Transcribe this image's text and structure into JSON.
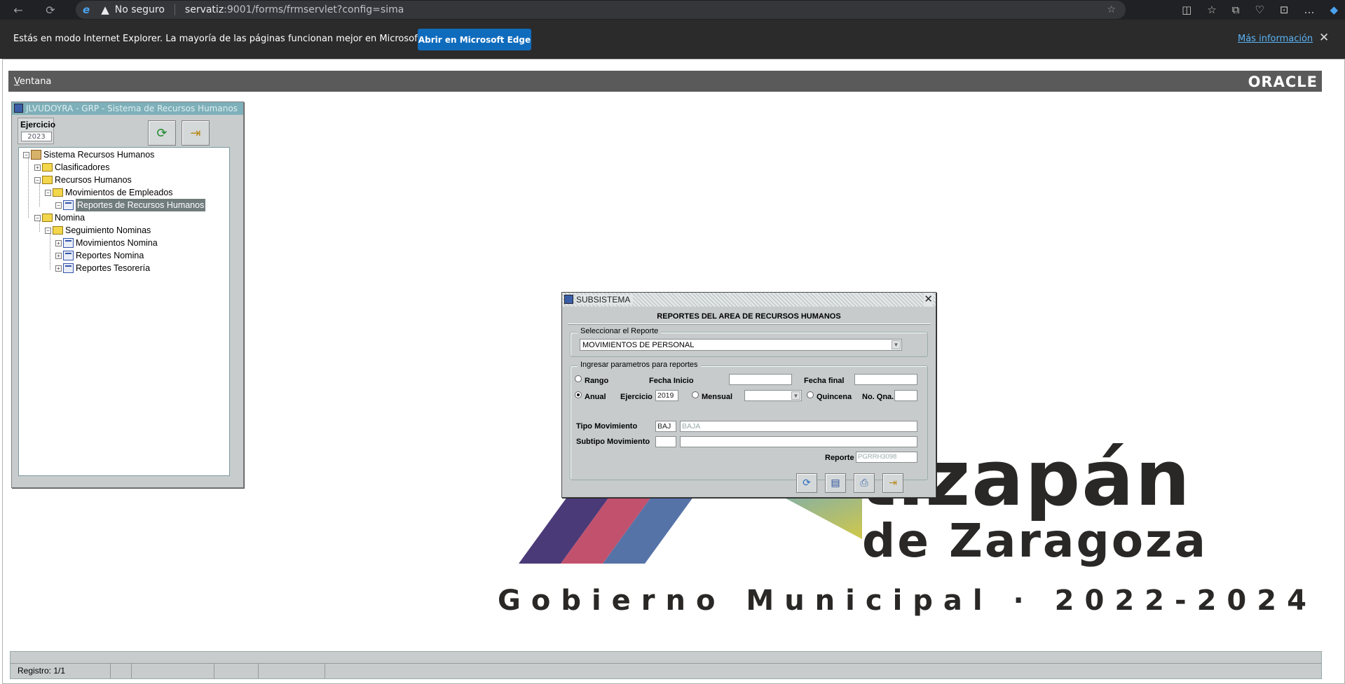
{
  "browser": {
    "security_label": "No seguro",
    "url_host": "servatiz",
    "url_rest": ":9001/forms/frmservlet?config=sima"
  },
  "ie_banner": {
    "message": "Estás en modo Internet Explorer. La mayoría de las páginas funcionan mejor en Microsoft Edge.",
    "open_button": "Abrir en Microsoft Edge",
    "more_link": "Más información"
  },
  "menubar": {
    "ventana_first": "V",
    "ventana_rest": "entana",
    "brand": "ORACLE"
  },
  "left_window": {
    "title": "JLVUDOYRA - GRP - Sistema de Recursos Humanos",
    "ejercicio_label": "Ejercicio",
    "ejercicio_value": "2023",
    "tree": {
      "root": "Sistema Recursos Humanos",
      "clasificadores": "Clasificadores",
      "recursos_humanos": "Recursos Humanos",
      "movimientos_empleados": "Movimientos de Empleados",
      "reportes_rh": "Reportes de Recursos Humanos",
      "nomina": "Nomina",
      "seguimiento": "Seguimiento Nominas",
      "movimientos_nomina": "Movimientos Nomina",
      "reportes_nomina": "Reportes Nomina",
      "reportes_tesoreria": "Reportes Tesorería"
    }
  },
  "dialog": {
    "title": "SUBSISTEMA",
    "heading": "REPORTES DEL AREA DE RECURSOS HUMANOS",
    "select_group": "Seleccionar el Reporte",
    "report_selected": "MOVIMIENTOS DE PERSONAL",
    "params_group": "Ingresar parametros para reportes",
    "rango": "Rango",
    "fecha_inicio": "Fecha Inicio",
    "fecha_inicio_value": "",
    "fecha_final": "Fecha final",
    "fecha_final_value": "",
    "anual": "Anual",
    "ejercicio": "Ejercicio",
    "ejercicio_value": "2019",
    "mensual": "Mensual",
    "mensual_value": "",
    "quincena": "Quincena",
    "no_qna": "No. Qna.",
    "no_qna_value": "",
    "tipo_movimiento": "Tipo Movimiento",
    "tipo_code": "BAJ",
    "tipo_desc": "BAJA",
    "subtipo_movimiento": "Subtipo Movimiento",
    "subtipo_code": "",
    "subtipo_desc": "",
    "reporte_label": "Reporte",
    "reporte_value": "PGRRH3098"
  },
  "background_logo": {
    "line1": "tizapán",
    "line2": "de Zaragoza",
    "line3": "Gobierno Municipal · 2022-2024"
  },
  "status": {
    "registro": "Registro: 1/1"
  },
  "colors": {
    "chrome_dark": "#202124",
    "banner": "#2b2b2b",
    "edge_button": "#0f6cbd",
    "forms_gray": "#c8cccd",
    "title_teal": "#7eb0ba",
    "menubar": "#5a5a5a"
  }
}
